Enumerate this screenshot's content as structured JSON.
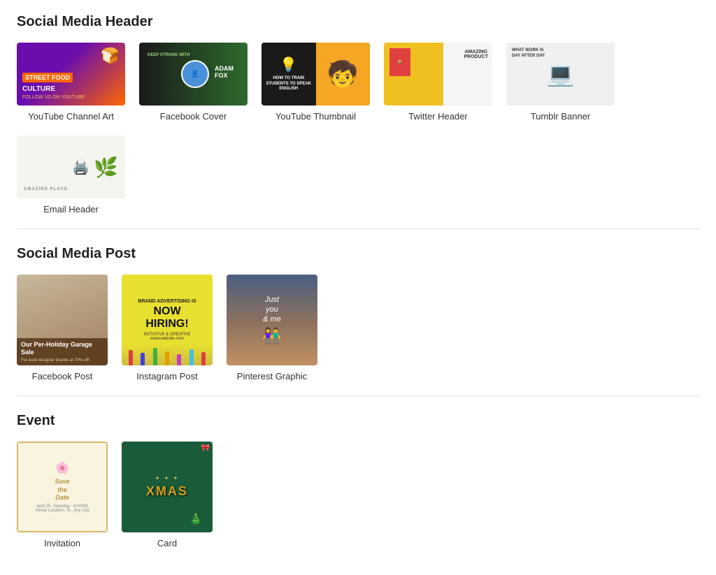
{
  "sections": [
    {
      "id": "social-media-header",
      "title": "Social Media Header",
      "items": [
        {
          "id": "yt-channel",
          "label": "YouTube Channel Art",
          "type": "yt-channel"
        },
        {
          "id": "fb-cover",
          "label": "Facebook Cover",
          "type": "fb-cover"
        },
        {
          "id": "yt-thumb",
          "label": "YouTube Thumbnail",
          "type": "yt-thumb"
        },
        {
          "id": "twitter-header",
          "label": "Twitter Header",
          "type": "twitter"
        },
        {
          "id": "tumblr-banner",
          "label": "Tumblr Banner",
          "type": "tumblr"
        },
        {
          "id": "email-header",
          "label": "Email Header",
          "type": "email"
        }
      ]
    },
    {
      "id": "social-media-post",
      "title": "Social Media Post",
      "items": [
        {
          "id": "fb-post",
          "label": "Facebook Post",
          "type": "fb-post",
          "square": true
        },
        {
          "id": "ig-post",
          "label": "Instagram Post",
          "type": "ig-post",
          "square": true
        },
        {
          "id": "pinterest",
          "label": "Pinterest Graphic",
          "type": "pinterest",
          "square": true
        }
      ]
    },
    {
      "id": "event",
      "title": "Event",
      "items": [
        {
          "id": "invitation",
          "label": "Invitation",
          "type": "invitation",
          "square": true
        },
        {
          "id": "card",
          "label": "Card",
          "type": "card",
          "square": true
        }
      ]
    }
  ]
}
